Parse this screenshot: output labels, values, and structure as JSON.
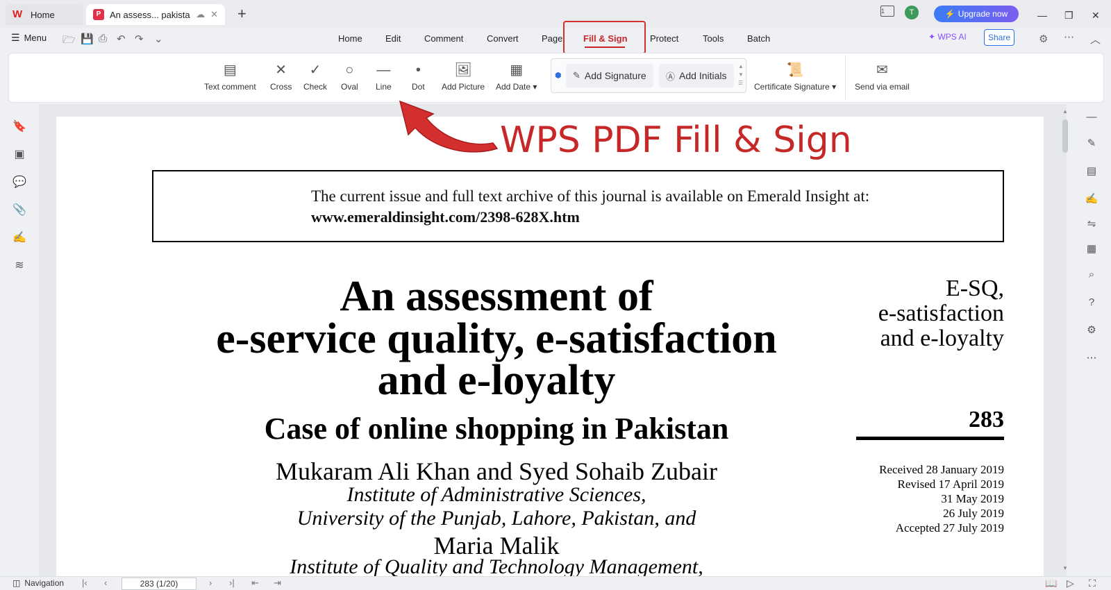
{
  "window": {
    "home_tab": "Home",
    "doc_tab": "An assess... pakistan",
    "new_tab": "+",
    "upgrade": "Upgrade now",
    "avatar_initial": "T",
    "reader_label": "1"
  },
  "menubar": {
    "menu_label": "Menu",
    "tabs": [
      "Home",
      "Edit",
      "Comment",
      "Convert",
      "Page",
      "Fill & Sign",
      "Protect",
      "Tools",
      "Batch"
    ],
    "active_tab": "Fill & Sign",
    "wps_ai": "WPS AI",
    "share": "Share"
  },
  "ribbon": {
    "tools": [
      {
        "label": "Text comment",
        "icon": "text-comment-icon"
      },
      {
        "label": "Cross",
        "icon": "cross-icon"
      },
      {
        "label": "Check",
        "icon": "check-icon"
      },
      {
        "label": "Oval",
        "icon": "oval-icon"
      },
      {
        "label": "Line",
        "icon": "line-icon"
      },
      {
        "label": "Dot",
        "icon": "dot-icon"
      },
      {
        "label": "Add Picture",
        "icon": "picture-icon"
      },
      {
        "label": "Add Date",
        "icon": "calendar-icon"
      }
    ],
    "add_signature": "Add Signature",
    "add_initials": "Add Initials",
    "certificate_signature": "Certificate Signature",
    "send_via_email": "Send via email"
  },
  "annotation": {
    "headline": "WPS PDF Fill & Sign",
    "color": "#c62828"
  },
  "document": {
    "journal_line1": "The current issue and full text archive of this journal is available on Emerald Insight at:",
    "journal_line2": "www.emeraldinsight.com/2398-628X.htm",
    "title_line1": "An assessment of",
    "title_line2": "e-service quality, e-satisfaction",
    "title_line3": "and e-loyalty",
    "subtitle": "Case of online shopping in Pakistan",
    "authors_line1": "Mukaram Ali Khan and Syed Sohaib Zubair",
    "affil_line1": "Institute of Administrative Sciences,",
    "affil_line2": "University of the Punjab, Lahore, Pakistan, and",
    "author2": "Maria Malik",
    "affil2": "Institute of Quality and Technology Management,",
    "side_title_1": "E-SQ,",
    "side_title_2": "e-satisfaction",
    "side_title_3": "and e-loyalty",
    "page_number": "283",
    "dates": [
      "Received 28 January 2019",
      "Revised 17 April 2019",
      "31 May 2019",
      "26 July 2019",
      "Accepted 27 July 2019"
    ]
  },
  "statusbar": {
    "navigation": "Navigation",
    "page_field": "283 (1/20)"
  }
}
